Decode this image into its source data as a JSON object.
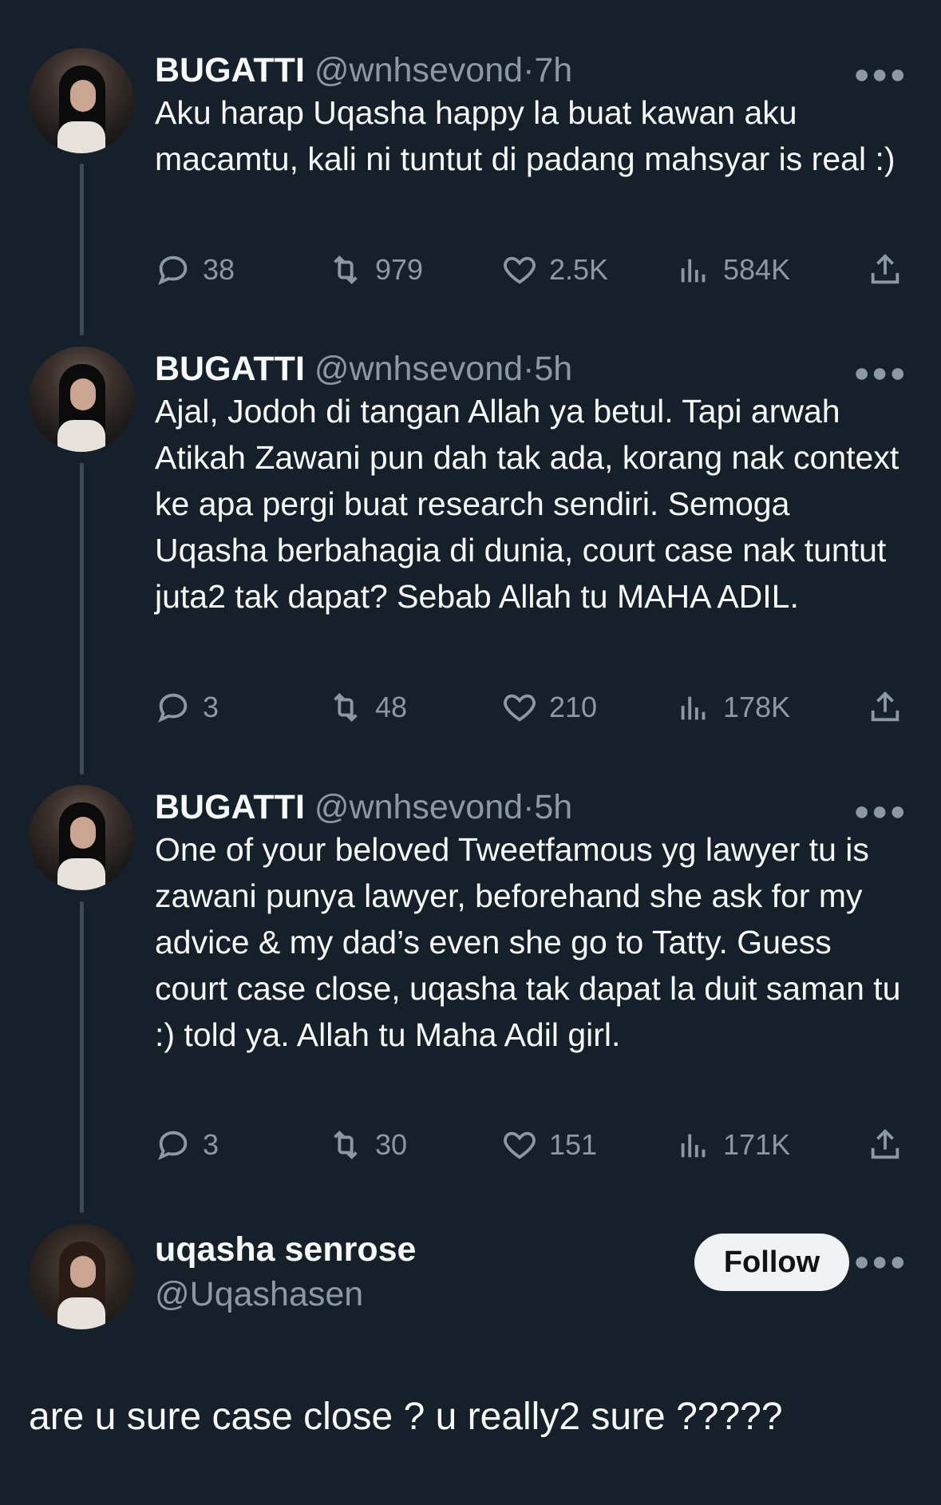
{
  "tweets": [
    {
      "name": "BUGATTI",
      "handle": "@wnhsevond",
      "dot": "·",
      "time": "7h",
      "text": "Aku harap Uqasha happy la buat kawan aku macamtu, kali ni tuntut di padang mahsyar is real :)",
      "replies": "38",
      "retweets": "979",
      "likes": "2.5K",
      "views": "584K"
    },
    {
      "name": "BUGATTI",
      "handle": "@wnhsevond",
      "dot": "·",
      "time": "5h",
      "text": "Ajal, Jodoh di tangan Allah ya betul. Tapi arwah Atikah Zawani pun dah tak ada, korang nak context ke apa pergi buat research sendiri. Semoga Uqasha berbahagia di dunia, court case nak tuntut juta2 tak dapat? Sebab Allah tu MAHA ADIL.",
      "replies": "3",
      "retweets": "48",
      "likes": "210",
      "views": "178K"
    },
    {
      "name": "BUGATTI",
      "handle": "@wnhsevond",
      "dot": "·",
      "time": "5h",
      "text": "One of your beloved Tweetfamous yg lawyer tu is zawani punya lawyer, beforehand she ask for my advice & my dad’s even she go to Tatty. Guess court case close, uqasha tak dapat la duit saman tu :) told ya. Allah tu Maha Adil girl.",
      "replies": "3",
      "retweets": "30",
      "likes": "151",
      "views": "171K"
    }
  ],
  "reply": {
    "name": "uqasha senrose",
    "handle": "@Uqashasen",
    "follow_label": "Follow",
    "text": "are u sure case close ? u really2 sure ?????"
  },
  "icons": {
    "more": "more-horizontal-icon",
    "reply": "reply-icon",
    "retweet": "retweet-icon",
    "like": "heart-icon",
    "views": "views-icon",
    "share": "share-icon"
  },
  "colors": {
    "background": "#15202b",
    "text": "#f7f9f9",
    "secondary": "#8b98a5",
    "thread_line": "#3b4a57",
    "follow_bg": "#eff3f4"
  }
}
